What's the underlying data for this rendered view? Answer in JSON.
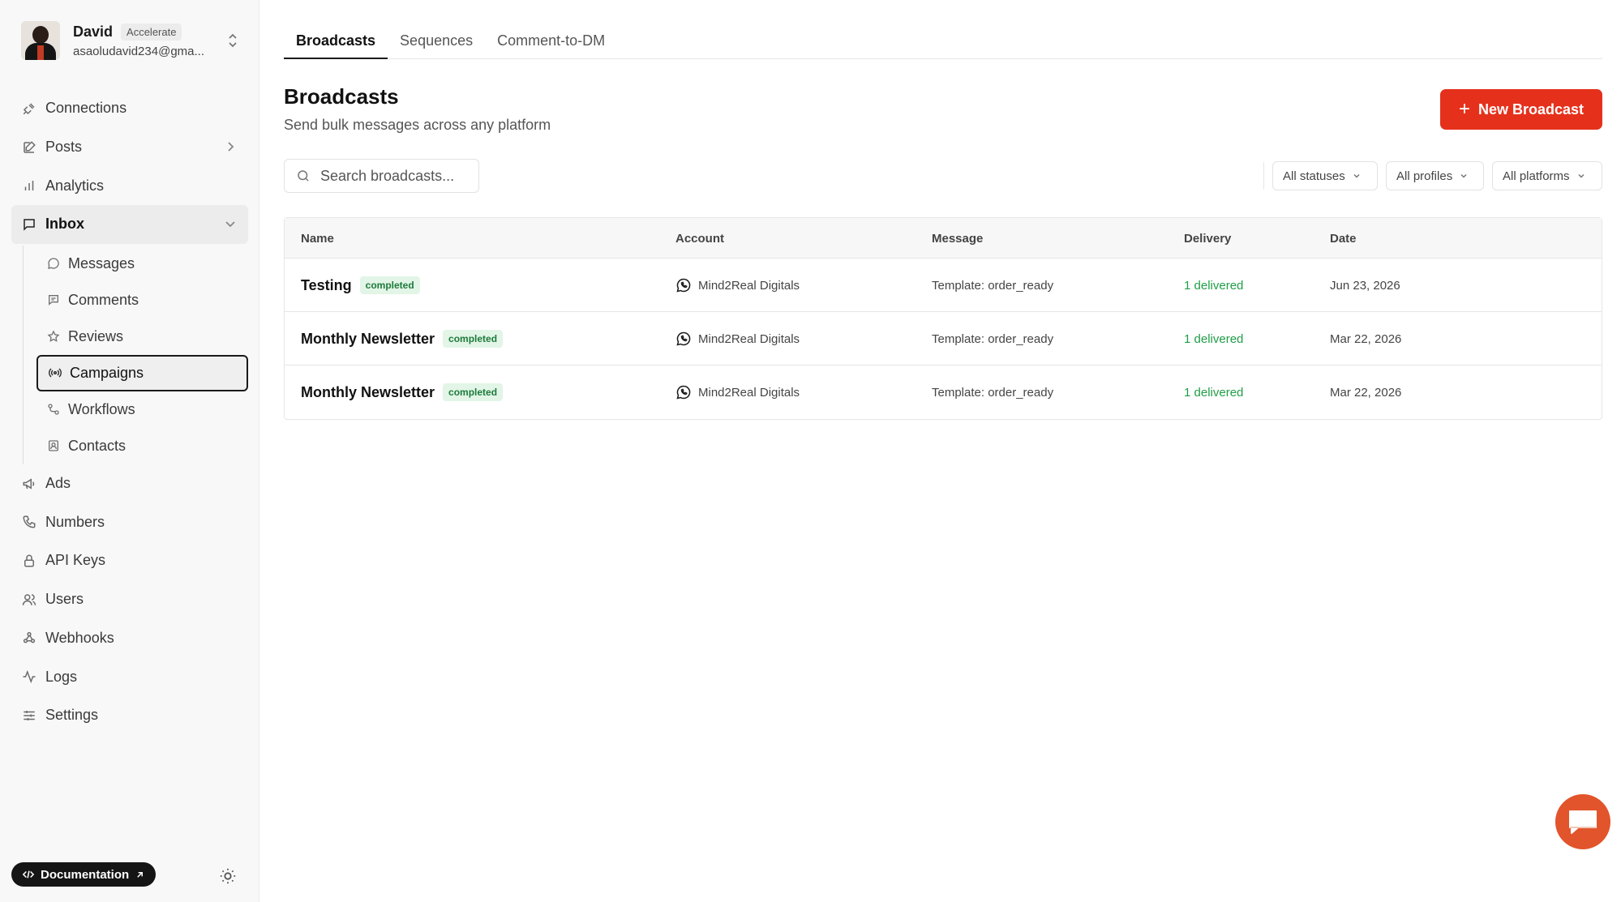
{
  "profile": {
    "name": "David",
    "plan": "Accelerate",
    "email": "asaoludavid234@gma..."
  },
  "nav": {
    "connections": "Connections",
    "posts": "Posts",
    "analytics": "Analytics",
    "inbox": "Inbox",
    "inbox_sub": {
      "messages": "Messages",
      "comments": "Comments",
      "reviews": "Reviews",
      "campaigns": "Campaigns",
      "workflows": "Workflows",
      "contacts": "Contacts"
    },
    "ads": "Ads",
    "numbers": "Numbers",
    "api_keys": "API Keys",
    "users": "Users",
    "webhooks": "Webhooks",
    "logs": "Logs",
    "settings": "Settings"
  },
  "footer": {
    "documentation": "Documentation"
  },
  "tabs": [
    "Broadcasts",
    "Sequences",
    "Comment-to-DM"
  ],
  "header": {
    "title": "Broadcasts",
    "subtitle": "Send bulk messages across any platform",
    "new_button": "New Broadcast"
  },
  "search": {
    "placeholder": "Search broadcasts..."
  },
  "filters": {
    "status": "All statuses",
    "profiles": "All profiles",
    "platforms": "All platforms"
  },
  "table": {
    "columns": [
      "Name",
      "Account",
      "Message",
      "Delivery",
      "Date"
    ],
    "rows": [
      {
        "name": "Testing",
        "status": "completed",
        "account": "Mind2Real Digitals",
        "message": "Template: order_ready",
        "delivery": "1 delivered",
        "date": "Jun 23, 2026"
      },
      {
        "name": "Monthly Newsletter",
        "status": "completed",
        "account": "Mind2Real Digitals",
        "message": "Template: order_ready",
        "delivery": "1 delivered",
        "date": "Mar 22, 2026"
      },
      {
        "name": "Monthly Newsletter",
        "status": "completed",
        "account": "Mind2Real Digitals",
        "message": "Template: order_ready",
        "delivery": "1 delivered",
        "date": "Mar 22, 2026"
      }
    ]
  },
  "colors": {
    "accent": "#e5311c",
    "delivered": "#1f9d47",
    "chat_fab": "#e2542b"
  },
  "icons": [
    "plug-icon",
    "edit-icon",
    "bar-chart-icon",
    "inbox-icon",
    "message-icon",
    "comment-icon",
    "star-icon",
    "broadcast-icon",
    "workflow-icon",
    "contacts-icon",
    "megaphone-icon",
    "phone-icon",
    "lock-icon",
    "users-icon",
    "webhook-icon",
    "activity-icon",
    "sliders-icon",
    "search-icon",
    "whatsapp-icon",
    "chat-icon",
    "sun-icon"
  ]
}
